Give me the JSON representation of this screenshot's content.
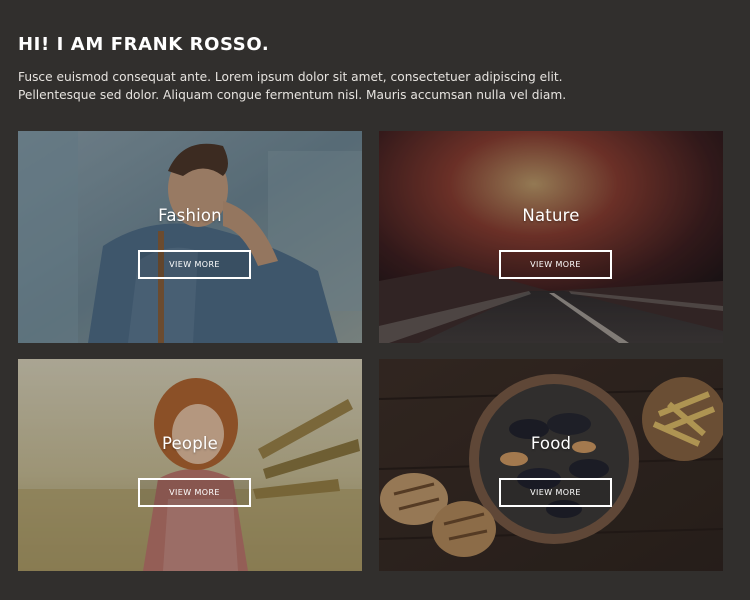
{
  "intro": {
    "heading": "HI! I AM FRANK ROSSO.",
    "text": "Fusce euismod consequat ante. Lorem ipsum dolor sit amet, consectetuer adipiscing elit. Pellentesque sed dolor. Aliquam congue fermentum nisl. Mauris accumsan nulla vel diam."
  },
  "cards": [
    {
      "title": "Fashion",
      "button": "VIEW MORE"
    },
    {
      "title": "Nature",
      "button": "VIEW MORE"
    },
    {
      "title": "People",
      "button": "VIEW MORE"
    },
    {
      "title": "Food",
      "button": "VIEW MORE"
    }
  ],
  "colors": {
    "background": "#312f2d",
    "text": "#ffffff"
  }
}
